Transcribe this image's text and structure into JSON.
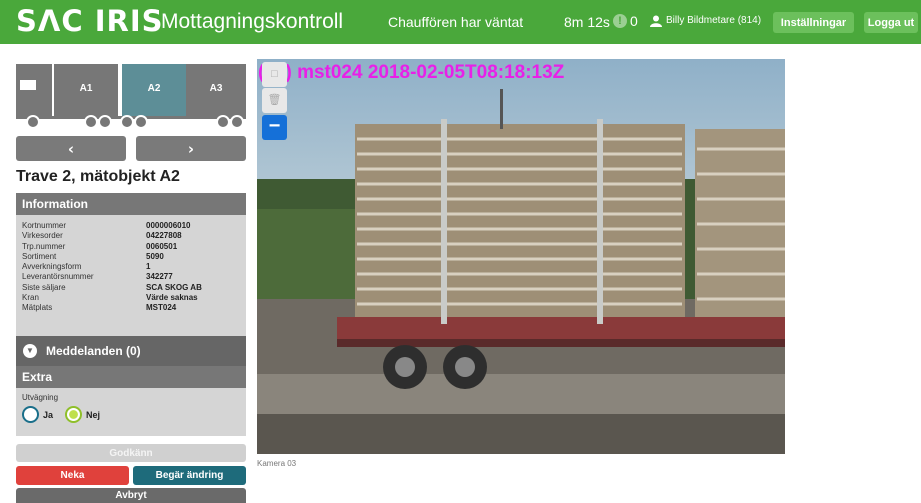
{
  "header": {
    "logo": "SΛC IRIS",
    "title": "Mottagningskontroll",
    "driver_waited": "Chauffören har väntat",
    "timer": "8m 12s",
    "alert_count": "0",
    "user": "Billy Bildmetare (814)",
    "settings_label": "Inställningar",
    "logout_label": "Logga ut",
    "color": "#4aa83b"
  },
  "truck": {
    "units": [
      "A1",
      "A2",
      "A3"
    ],
    "selected": "A2",
    "prev_icon": "‹",
    "next_icon": "›"
  },
  "pile_title": "Trave 2, mätobjekt A2",
  "information": {
    "heading": "Information",
    "rows": [
      {
        "key": "Kortnummer",
        "value": "0000006010"
      },
      {
        "key": "Virkesorder",
        "value": "04227808"
      },
      {
        "key": "Trp.nummer",
        "value": "0060501"
      },
      {
        "key": "Sortiment",
        "value": "5090"
      },
      {
        "key": "Avverkningsform",
        "value": "1"
      },
      {
        "key": "Leverantörsnummer",
        "value": "342277"
      },
      {
        "key": "Siste säljare",
        "value": "SCA SKOG AB"
      },
      {
        "key": "Kran",
        "value": "Värde saknas"
      },
      {
        "key": "Mätplats",
        "value": "MST024"
      }
    ]
  },
  "messages": {
    "heading": "Meddelanden (0)"
  },
  "extra": {
    "heading": "Extra",
    "label": "Utvägning",
    "options": [
      {
        "label": "Ja",
        "checked": false
      },
      {
        "label": "Nej",
        "checked": true
      }
    ]
  },
  "actions": {
    "approve": "Godkänn",
    "reject": "Neka",
    "request_change": "Begär ändring",
    "cancel": "Avbryt"
  },
  "camera": {
    "overlay_title": "(03) mst024 2018-02-05T08:18:13Z",
    "caption": "Kamera 03"
  }
}
